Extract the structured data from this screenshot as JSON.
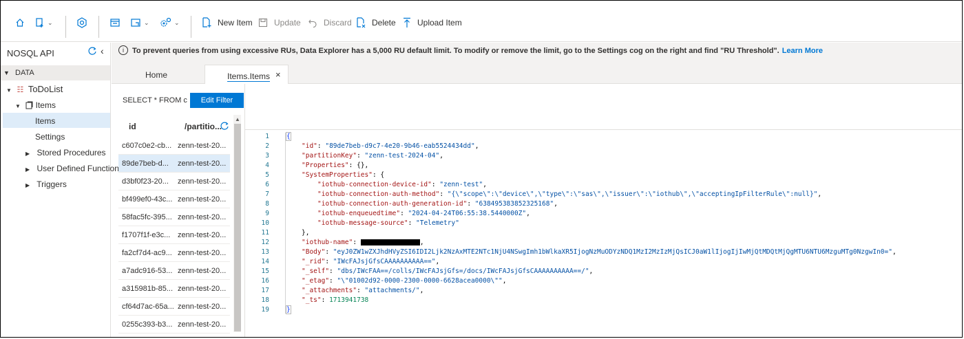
{
  "toolbar": {
    "new_item": "New Item",
    "update": "Update",
    "discard": "Discard",
    "delete": "Delete",
    "upload_item": "Upload Item"
  },
  "sidebar": {
    "api_title": "NOSQL API",
    "data_header": "DATA",
    "database": "ToDoList",
    "container": "Items",
    "items": [
      "Items",
      "Settings",
      "Stored Procedures",
      "User Defined Functions",
      "Triggers"
    ]
  },
  "infobar": {
    "text": "To prevent queries from using excessive RUs, Data Explorer has a 5,000 RU default limit. To modify or remove the limit, go to the Settings cog on the right and find \"RU Threshold\".",
    "link": "Learn More"
  },
  "tabs": {
    "home": "Home",
    "items": "Items.Items",
    "close": "×"
  },
  "query": {
    "text": "SELECT * FROM c",
    "edit_filter": "Edit Filter"
  },
  "grid": {
    "col_id": "id",
    "col_pk": "/partitio...",
    "selected_index": 1,
    "rows": [
      {
        "id": "c607c0e2-cb...",
        "pk": "zenn-test-20..."
      },
      {
        "id": "89de7beb-d...",
        "pk": "zenn-test-20..."
      },
      {
        "id": "d3bf0f23-20...",
        "pk": "zenn-test-20..."
      },
      {
        "id": "bf499ef0-43c...",
        "pk": "zenn-test-20..."
      },
      {
        "id": "58fac5fc-395...",
        "pk": "zenn-test-20..."
      },
      {
        "id": "f1707f1f-e3c...",
        "pk": "zenn-test-20..."
      },
      {
        "id": "fa2cf7d4-ac9...",
        "pk": "zenn-test-20..."
      },
      {
        "id": "a7adc916-53...",
        "pk": "zenn-test-20..."
      },
      {
        "id": "a315981b-85...",
        "pk": "zenn-test-20..."
      },
      {
        "id": "cf64d7ac-65a...",
        "pk": "zenn-test-20..."
      },
      {
        "id": "0255c393-b3...",
        "pk": "zenn-test-20..."
      }
    ]
  },
  "editor": {
    "line_numbers": [
      "1",
      "2",
      "3",
      "4",
      "5",
      "6",
      "7",
      "8",
      "9",
      "10",
      "11",
      "12",
      "13",
      "14",
      "15",
      "16",
      "17",
      "18",
      "19"
    ],
    "lines": [
      {
        "indent": 0,
        "key": "",
        "value": "{",
        "vtype": "p"
      },
      {
        "indent": 1,
        "key": "\"id\"",
        "value": "\"89de7beb-d9c7-4e20-9b46-eab5524434dd\"",
        "vtype": "s",
        "comma": true
      },
      {
        "indent": 1,
        "key": "\"partitionKey\"",
        "value": "\"zenn-test-2024-04\"",
        "vtype": "s",
        "comma": true
      },
      {
        "indent": 1,
        "key": "\"Properties\"",
        "value": "{}",
        "vtype": "p",
        "comma": true
      },
      {
        "indent": 1,
        "key": "\"SystemProperties\"",
        "value": "{",
        "vtype": "p"
      },
      {
        "indent": 2,
        "key": "\"iothub-connection-device-id\"",
        "value": "\"zenn-test\"",
        "vtype": "s",
        "comma": true
      },
      {
        "indent": 2,
        "key": "\"iothub-connection-auth-method\"",
        "value": "\"{\\\"scope\\\":\\\"device\\\",\\\"type\\\":\\\"sas\\\",\\\"issuer\\\":\\\"iothub\\\",\\\"acceptingIpFilterRule\\\":null}\"",
        "vtype": "s",
        "comma": true
      },
      {
        "indent": 2,
        "key": "\"iothub-connection-auth-generation-id\"",
        "value": "\"638495383852325168\"",
        "vtype": "s",
        "comma": true
      },
      {
        "indent": 2,
        "key": "\"iothub-enqueuedtime\"",
        "value": "\"2024-04-24T06:55:38.5440000Z\"",
        "vtype": "s",
        "comma": true
      },
      {
        "indent": 2,
        "key": "\"iothub-message-source\"",
        "value": "\"Telemetry\"",
        "vtype": "s"
      },
      {
        "indent": 1,
        "key": "",
        "value": "},",
        "vtype": "p"
      },
      {
        "indent": 1,
        "key": "\"iothub-name\"",
        "value": "",
        "vtype": "redacted",
        "comma": true
      },
      {
        "indent": 1,
        "key": "\"Body\"",
        "value": "\"eyJ0ZW1wZXJhdHVyZSI6IDI2Ljk2NzAxMTE2NTc1NjU4NSwgImh1bWlkaXR5IjogNzMuODYzNDQ1MzI2MzIzMjQsICJ0aW1lIjogIjIwMjQtMDQtMjQgMTU6NTU6MzguMTg0NzgwIn0=\"",
        "vtype": "s",
        "comma": true
      },
      {
        "indent": 1,
        "key": "\"_rid\"",
        "value": "\"IWcFAJsjGfsCAAAAAAAAAA==\"",
        "vtype": "s",
        "comma": true
      },
      {
        "indent": 1,
        "key": "\"_self\"",
        "value": "\"dbs/IWcFAA==/colls/IWcFAJsjGfs=/docs/IWcFAJsjGfsCAAAAAAAAAA==/\"",
        "vtype": "s",
        "comma": true
      },
      {
        "indent": 1,
        "key": "\"_etag\"",
        "value": "\"\\\"01002d92-0000-2300-0000-6628acea0000\\\"\"",
        "vtype": "s",
        "comma": true
      },
      {
        "indent": 1,
        "key": "\"_attachments\"",
        "value": "\"attachments/\"",
        "vtype": "s",
        "comma": true
      },
      {
        "indent": 1,
        "key": "\"_ts\"",
        "value": "1713941738",
        "vtype": "n"
      },
      {
        "indent": 0,
        "key": "",
        "value": "}",
        "vtype": "p"
      }
    ]
  },
  "colors": {
    "accent": "#0078d4",
    "selection": "#deecf9",
    "json_key": "#a31515",
    "json_string": "#0451a5",
    "json_number": "#098658"
  }
}
